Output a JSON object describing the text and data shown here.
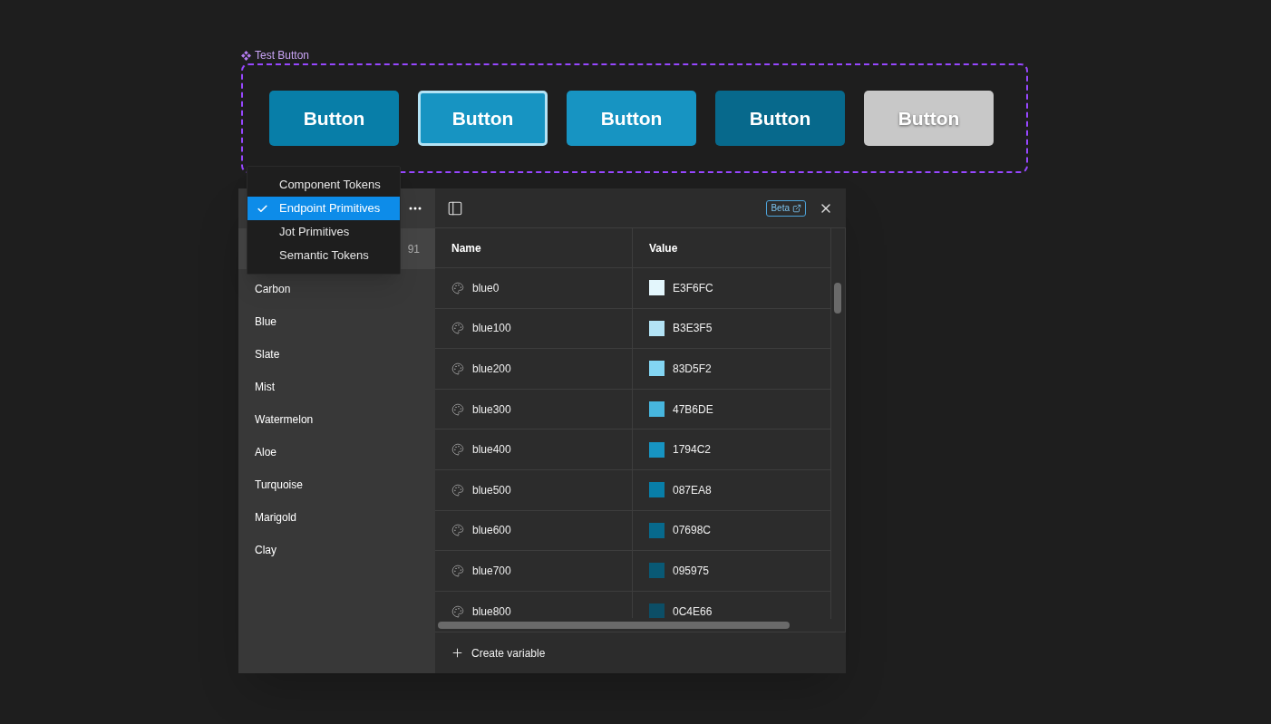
{
  "component": {
    "label": "Test Button",
    "buttons": [
      {
        "label": "Button",
        "color": "#087ea8",
        "focused": false,
        "disabled": false
      },
      {
        "label": "Button",
        "color": "#1794c2",
        "focused": true,
        "disabled": false
      },
      {
        "label": "Button",
        "color": "#1794c2",
        "focused": false,
        "disabled": false
      },
      {
        "label": "Button",
        "color": "#07698c",
        "focused": false,
        "disabled": false
      },
      {
        "label": "Button",
        "color": "#c8c8c8",
        "focused": false,
        "disabled": true
      }
    ]
  },
  "collections_menu": [
    {
      "label": "Component Tokens",
      "selected": false
    },
    {
      "label": "Endpoint Primitives",
      "selected": true
    },
    {
      "label": "Jot Primitives",
      "selected": false
    },
    {
      "label": "Semantic Tokens",
      "selected": false
    }
  ],
  "sidebar": {
    "selected_count": "91",
    "groups": [
      {
        "label": "Carbon",
        "selected": false
      },
      {
        "label": "Blue",
        "selected": false
      },
      {
        "label": "Slate",
        "selected": false
      },
      {
        "label": "Mist",
        "selected": false
      },
      {
        "label": "Watermelon",
        "selected": false
      },
      {
        "label": "Aloe",
        "selected": false
      },
      {
        "label": "Turquoise",
        "selected": false
      },
      {
        "label": "Marigold",
        "selected": false
      },
      {
        "label": "Clay",
        "selected": false
      }
    ]
  },
  "toolbar": {
    "badge": "Beta"
  },
  "table": {
    "columns": [
      "Name",
      "Value"
    ],
    "rows": [
      {
        "name": "blue0",
        "value": "E3F6FC",
        "color": "#e3f6fc"
      },
      {
        "name": "blue100",
        "value": "B3E3F5",
        "color": "#b3e3f5"
      },
      {
        "name": "blue200",
        "value": "83D5F2",
        "color": "#83d5f2"
      },
      {
        "name": "blue300",
        "value": "47B6DE",
        "color": "#47b6de"
      },
      {
        "name": "blue400",
        "value": "1794C2",
        "color": "#1794c2"
      },
      {
        "name": "blue500",
        "value": "087EA8",
        "color": "#087ea8"
      },
      {
        "name": "blue600",
        "value": "07698C",
        "color": "#07698c"
      },
      {
        "name": "blue700",
        "value": "095975",
        "color": "#095975"
      },
      {
        "name": "blue800",
        "value": "0C4E66",
        "color": "#0c4e66"
      }
    ]
  },
  "footer": {
    "action": "Create variable"
  }
}
